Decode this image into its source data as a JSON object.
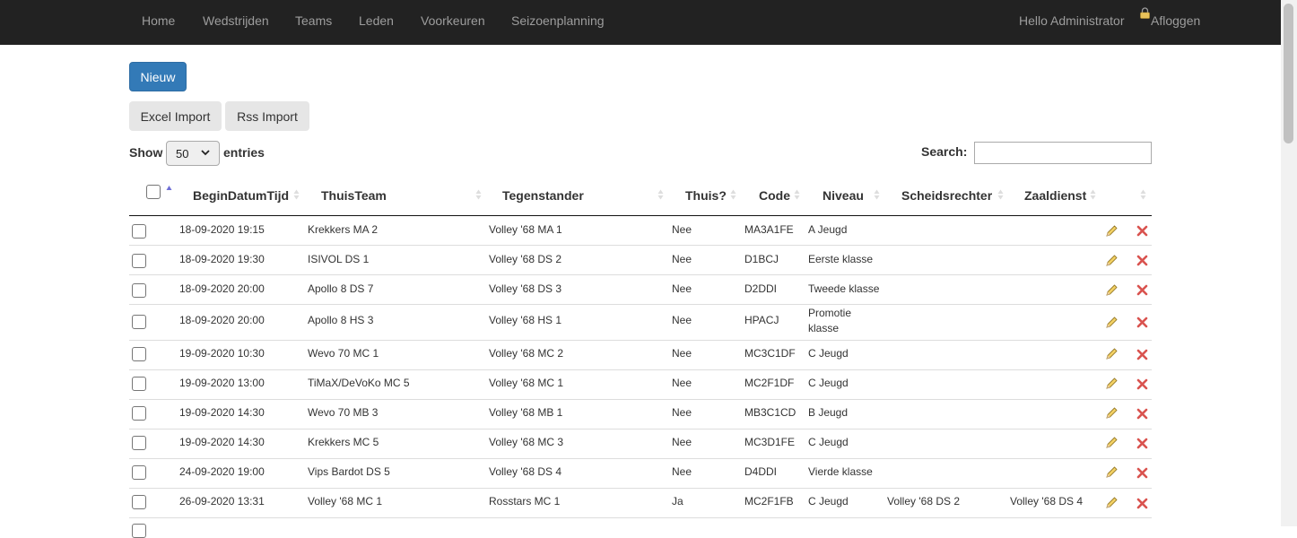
{
  "nav": {
    "items": [
      "Home",
      "Wedstrijden",
      "Teams",
      "Leden",
      "Voorkeuren",
      "Seizoenplanning"
    ],
    "greeting": "Hello Administrator",
    "logout": "Afloggen"
  },
  "toolbar": {
    "new_label": "Nieuw",
    "excel_import_label": "Excel Import",
    "rss_import_label": "Rss Import"
  },
  "length_control": {
    "show_label": "Show",
    "selected": "50",
    "entries_label": "entries"
  },
  "search": {
    "label": "Search:",
    "value": ""
  },
  "table": {
    "columns": [
      "BeginDatumTijd",
      "ThuisTeam",
      "Tegenstander",
      "Thuis?",
      "Code",
      "Niveau",
      "Scheidsrechter",
      "Zaaldienst"
    ],
    "rows": [
      {
        "datetime": "18-09-2020 19:15",
        "home": "Krekkers MA 2",
        "opponent": "Volley '68 MA 1",
        "thuis": "Nee",
        "code": "MA3A1FE",
        "niveau": "A Jeugd",
        "scheids": "",
        "zaal": ""
      },
      {
        "datetime": "18-09-2020 19:30",
        "home": "ISIVOL DS 1",
        "opponent": "Volley '68 DS 2",
        "thuis": "Nee",
        "code": "D1BCJ",
        "niveau": "Eerste klasse",
        "scheids": "",
        "zaal": ""
      },
      {
        "datetime": "18-09-2020 20:00",
        "home": "Apollo 8 DS 7",
        "opponent": "Volley '68 DS 3",
        "thuis": "Nee",
        "code": "D2DDI",
        "niveau": "Tweede klasse",
        "scheids": "",
        "zaal": ""
      },
      {
        "datetime": "18-09-2020 20:00",
        "home": "Apollo 8 HS 3",
        "opponent": "Volley '68 HS 1",
        "thuis": "Nee",
        "code": "HPACJ",
        "niveau": "Promotie",
        "niveau2": "klasse",
        "scheids": "",
        "zaal": ""
      },
      {
        "datetime": "19-09-2020 10:30",
        "home": "Wevo 70 MC 1",
        "opponent": "Volley '68 MC 2",
        "thuis": "Nee",
        "code": "MC3C1DF",
        "niveau": "C Jeugd",
        "scheids": "",
        "zaal": ""
      },
      {
        "datetime": "19-09-2020 13:00",
        "home": "TiMaX/DeVoKo MC 5",
        "opponent": "Volley '68 MC 1",
        "thuis": "Nee",
        "code": "MC2F1DF",
        "niveau": "C Jeugd",
        "scheids": "",
        "zaal": ""
      },
      {
        "datetime": "19-09-2020 14:30",
        "home": "Wevo 70 MB 3",
        "opponent": "Volley '68 MB 1",
        "thuis": "Nee",
        "code": "MB3C1CD",
        "niveau": "B Jeugd",
        "scheids": "",
        "zaal": ""
      },
      {
        "datetime": "19-09-2020 14:30",
        "home": "Krekkers MC 5",
        "opponent": "Volley '68 MC 3",
        "thuis": "Nee",
        "code": "MC3D1FE",
        "niveau": "C Jeugd",
        "scheids": "",
        "zaal": ""
      },
      {
        "datetime": "24-09-2020 19:00",
        "home": "Vips Bardot DS 5",
        "opponent": "Volley '68 DS 4",
        "thuis": "Nee",
        "code": "D4DDI",
        "niveau": "Vierde klasse",
        "scheids": "",
        "zaal": ""
      },
      {
        "datetime": "26-09-2020 13:31",
        "home": "Volley '68 MC 1",
        "opponent": "Rosstars MC 1",
        "thuis": "Ja",
        "code": "MC2F1FB",
        "niveau": "C Jeugd",
        "scheids": "Volley '68 DS 2",
        "zaal": "Volley '68 DS 4"
      }
    ]
  },
  "icons": {
    "edit": "pencil-icon",
    "delete": "close-icon",
    "lock": "lock-icon"
  },
  "colors": {
    "navbar": "#222222",
    "primary": "#337ab7",
    "delete": "#d9534f"
  }
}
